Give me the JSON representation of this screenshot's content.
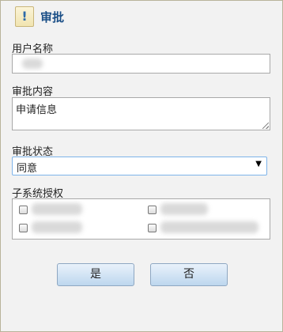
{
  "dialog": {
    "title": "审批",
    "header_icon_glyph": "!",
    "header_icon": "exclamation-icon"
  },
  "form": {
    "username_label": "用户名称",
    "content_label": "审批内容",
    "content_value": "申请信息",
    "status_label": "审批状态",
    "status_value": "同意",
    "subsystem_label": "子系统授权"
  },
  "buttons": {
    "yes_label": "是",
    "no_label": "否"
  },
  "colors": {
    "title": "#1b4f87",
    "button_top": "#e9f2fb",
    "button_bottom": "#bdd7ee",
    "select_border": "#7eb4ea"
  }
}
